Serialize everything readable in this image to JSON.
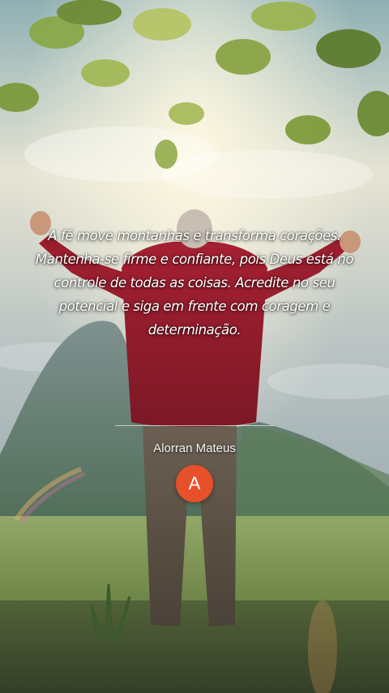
{
  "quote": {
    "text": "A fé move montanhas e transforma corações. Mantenha-se firme e confiante, pois Deus está no controle de todas as coisas. Acredite no seu potencial e siga em frente com coragem e determinação."
  },
  "author": {
    "name": "Alorran Mateus",
    "avatar_initial": "A",
    "avatar_color": "#e8502a"
  }
}
